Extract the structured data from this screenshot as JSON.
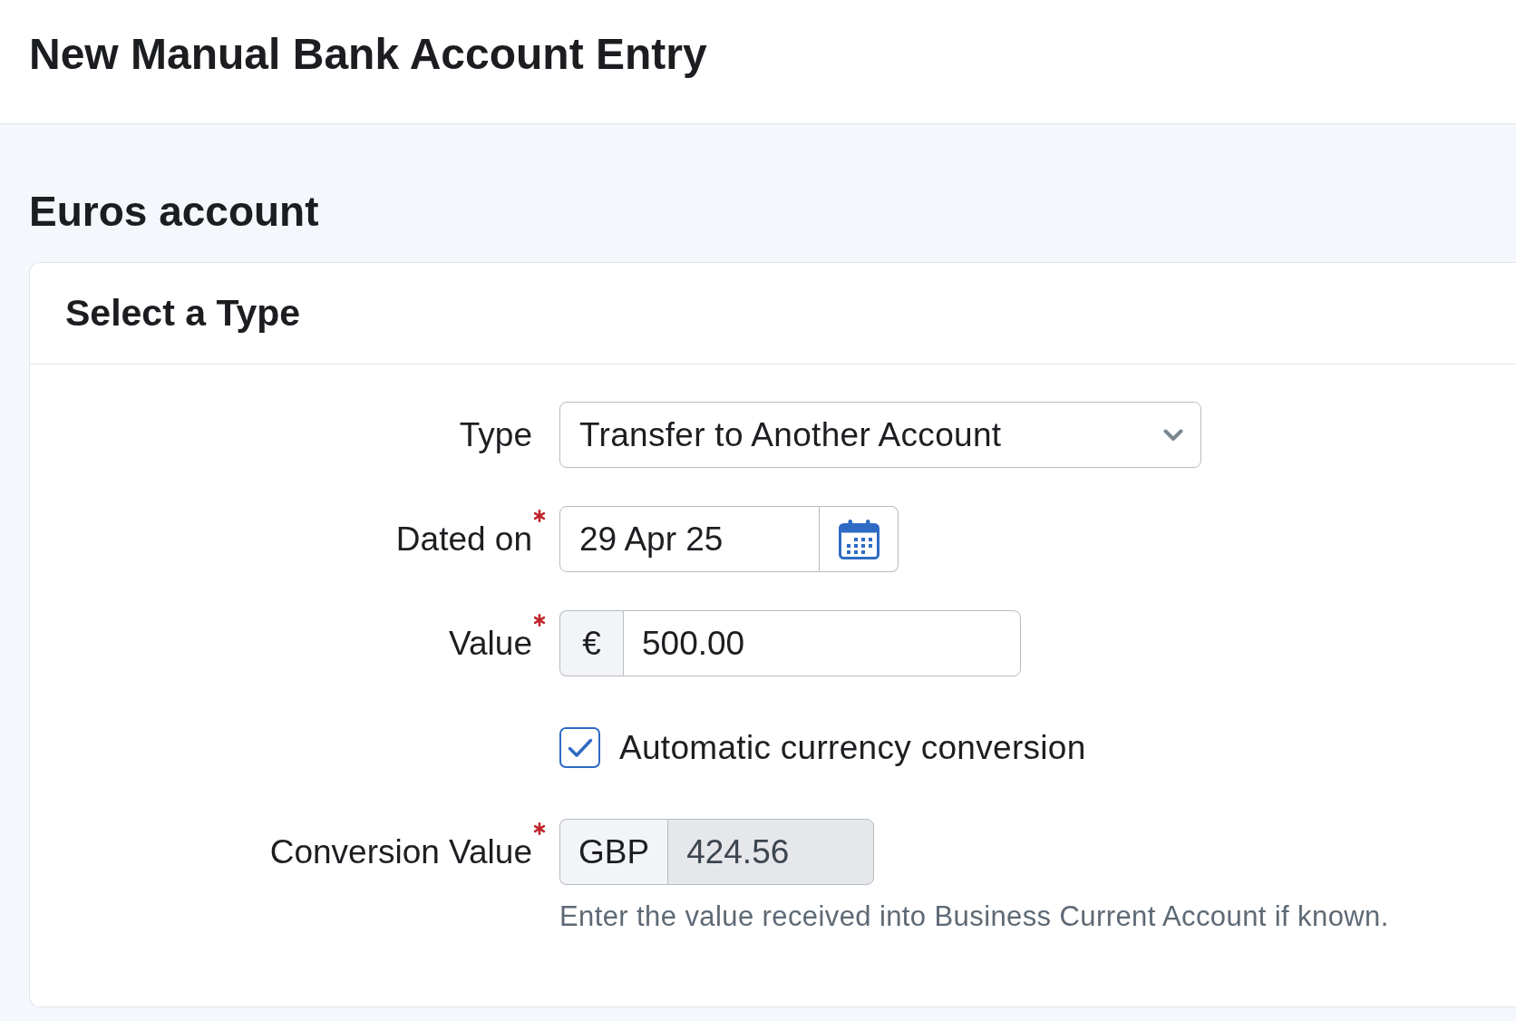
{
  "page_header": {
    "title": "New Manual Bank Account Entry"
  },
  "account": {
    "title": "Euros account",
    "card": {
      "title": "Select a Type",
      "fields": [
        {
          "kind": "select",
          "label": "Type",
          "required": false,
          "value": "Transfer to Another Account"
        },
        {
          "kind": "date",
          "label": "Dated on",
          "required": true,
          "value": "29 Apr 25"
        },
        {
          "kind": "amount",
          "label": "Value",
          "required": true,
          "prefix": "€",
          "value": "500.00",
          "disabled": false
        },
        {
          "kind": "checkbox",
          "label": "Automatic currency conversion",
          "checked": true
        },
        {
          "kind": "amount",
          "label": "Conversion Value",
          "required": true,
          "prefix": "GBP",
          "value": "424.56",
          "disabled": true,
          "help": "Enter the value received into Business Current Account if known."
        }
      ]
    }
  }
}
